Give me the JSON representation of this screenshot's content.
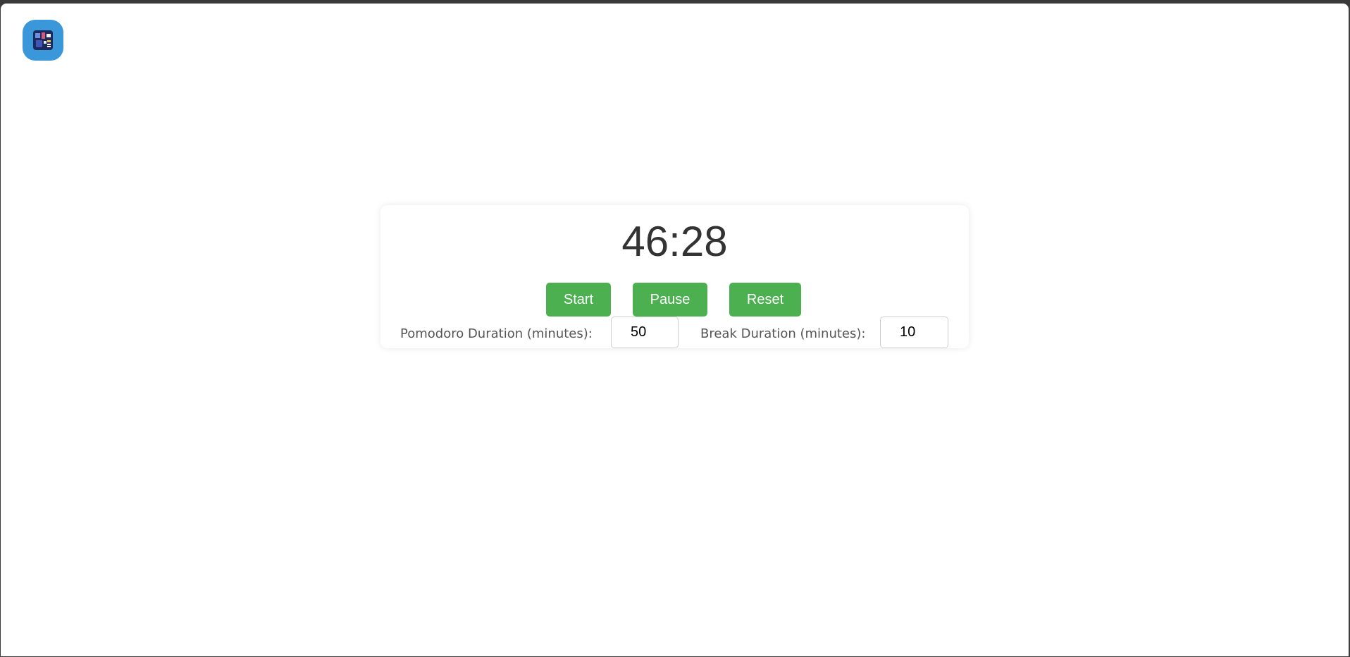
{
  "app": {
    "icon_name": "app-logo-icon",
    "icon_color": "#3a97d9"
  },
  "timer": {
    "display": "46:28"
  },
  "controls": {
    "start_label": "Start",
    "pause_label": "Pause",
    "reset_label": "Reset",
    "button_color": "#4caf50"
  },
  "settings": {
    "pomodoro_label": "Pomodoro Duration (minutes):",
    "pomodoro_value": "50",
    "break_label": "Break Duration (minutes):",
    "break_value": "10"
  }
}
